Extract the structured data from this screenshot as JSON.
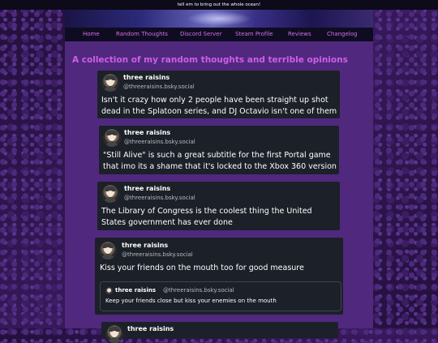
{
  "announcement": "tell em to bring out the whole ocean!",
  "nav": {
    "items": [
      {
        "label": "Home"
      },
      {
        "label": "Random Thoughts"
      },
      {
        "label": "Discord Server"
      },
      {
        "label": "Steam Profile"
      },
      {
        "label": "Reviews"
      },
      {
        "label": "Changelog"
      }
    ]
  },
  "page": {
    "heading": "A collection of my random thoughts and terrible opinions"
  },
  "posts": [
    {
      "author": "three raisins",
      "handle": "@threeraisins.bsky.social",
      "text": "Isn't it crazy how only 2 people have been straight up shot dead in the Splatoon series, and DJ Octavio isn't one of them"
    },
    {
      "author": "three raisins",
      "handle": "@threeraisins.bsky.social",
      "text": "\"Still Alive\" is such a great subtitle for the first Portal game that imo its a shame that it's locked to the Xbox 360 version"
    },
    {
      "author": "three raisins",
      "handle": "@threeraisins.bsky.social",
      "text": "The Library of Congress is the coolest thing the United States government has ever done"
    },
    {
      "author": "three raisins",
      "handle": "@threeraisins.bsky.social",
      "text": "Kiss your friends on the mouth too for good measure",
      "quote": {
        "author": "three raisins",
        "handle": "@threeraisins.bsky.social",
        "text": "Keep your friends close but kiss your enemies on the mouth"
      }
    },
    {
      "author": "three raisins",
      "handle": ""
    }
  ],
  "colors": {
    "accent": "#d05de8",
    "panel": "#50297e",
    "card": "#1c2028",
    "nav_bg": "#0f0c22"
  }
}
